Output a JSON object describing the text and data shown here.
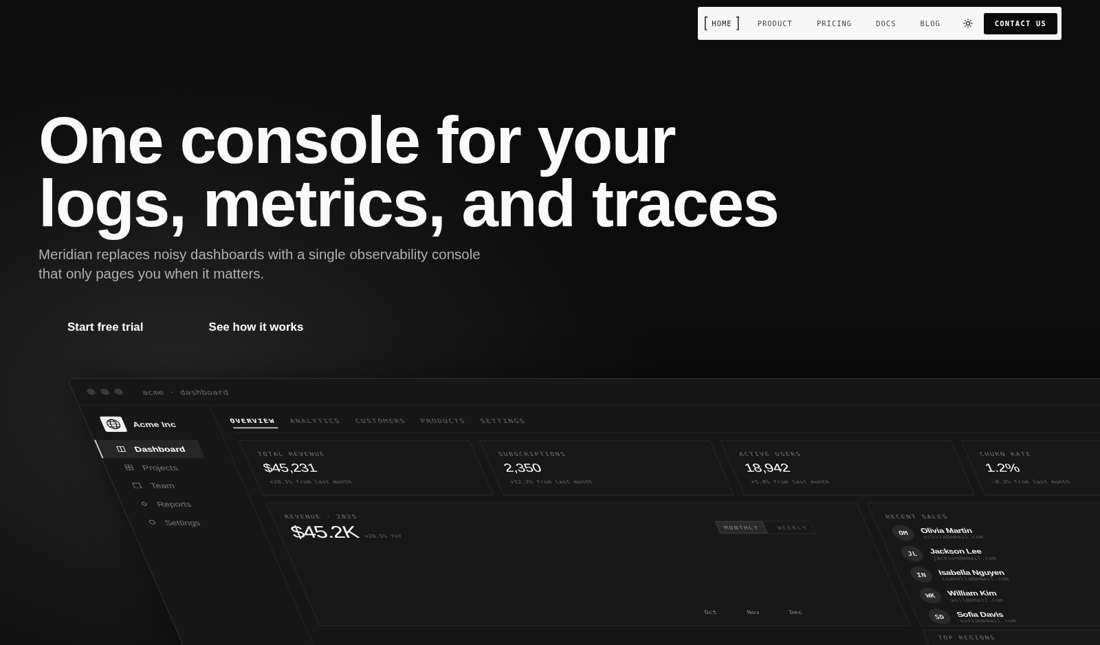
{
  "nav": {
    "items": [
      {
        "label": "HOME",
        "selected": true
      },
      {
        "label": "PRODUCT",
        "selected": false
      },
      {
        "label": "PRICING",
        "selected": false
      },
      {
        "label": "DOCS",
        "selected": false
      },
      {
        "label": "BLOG",
        "selected": false
      }
    ],
    "contact": "CONTACT US"
  },
  "hero": {
    "headline": "One console for your\nlogs, metrics, and traces",
    "subtitle": "Meridian replaces noisy dashboards with a single observability console\nthat only pages you when it matters.",
    "actions": [
      "Start free trial",
      "See how it works"
    ]
  },
  "dashboard": {
    "title": "acme · dashboard",
    "brand": "Acme Inc",
    "sidebar": [
      {
        "label": "Dashboard",
        "selected": true
      },
      {
        "label": "Projects",
        "selected": false
      },
      {
        "label": "Team",
        "selected": false
      },
      {
        "label": "Reports",
        "selected": false
      },
      {
        "label": "Settings",
        "selected": false
      }
    ],
    "tabs": [
      {
        "label": "OVERVIEW",
        "selected": true
      },
      {
        "label": "ANALYTICS",
        "selected": false
      },
      {
        "label": "CUSTOMERS",
        "selected": false
      },
      {
        "label": "PRODUCTS",
        "selected": false
      },
      {
        "label": "SETTINGS",
        "selected": false
      }
    ],
    "stats": [
      {
        "label": "TOTAL REVENUE",
        "value": "$45,231",
        "change": "+20.1% from last month"
      },
      {
        "label": "SUBSCRIPTIONS",
        "value": "2,350",
        "change": "+12.2% from last month"
      },
      {
        "label": "ACTIVE USERS",
        "value": "18,942",
        "change": "+5.4% from last month"
      },
      {
        "label": "CHURN RATE",
        "value": "1.2%",
        "change": "-0.3% from last month"
      }
    ],
    "revenue": {
      "label": "REVENUE · 2025",
      "value": "$45.2K",
      "change": "+20.1% YoY",
      "periods": [
        {
          "label": "MONTHLY",
          "selected": true
        },
        {
          "label": "WEEKLY",
          "selected": false
        }
      ],
      "months": [
        "Oct",
        "Nov",
        "Dec"
      ]
    },
    "recent_sales": {
      "title": "RECENT SALES",
      "people": [
        {
          "initials": "OM",
          "name": "Olivia Martin",
          "email": "olivia@email.com"
        },
        {
          "initials": "JL",
          "name": "Jackson Lee",
          "email": "jackson@email.com"
        },
        {
          "initials": "IN",
          "name": "Isabella Nguyen",
          "email": "isabella@email.com"
        },
        {
          "initials": "WK",
          "name": "William Kim",
          "email": "will@email.com"
        },
        {
          "initials": "SD",
          "name": "Sofia Davis",
          "email": "sofia@email.com"
        }
      ]
    },
    "top_regions": {
      "title": "TOP REGIONS"
    }
  }
}
